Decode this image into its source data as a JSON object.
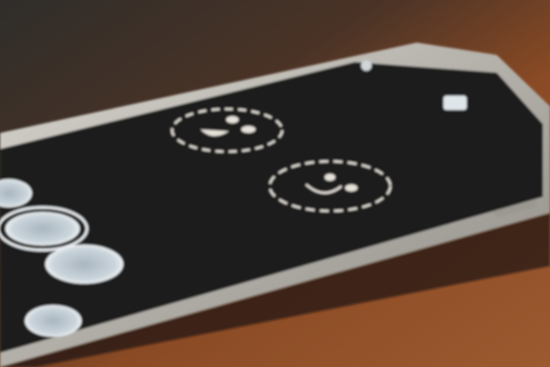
{
  "scene": {
    "subject": "smartphone",
    "colors": {
      "background_dark": "#2e2a26",
      "wood": "#8a4a24",
      "wood_light": "#b0693a",
      "phone_frame": "#c9c6bf",
      "screen": "#1e1d1a",
      "bubble": "#b9c7d2",
      "dashed_outline": "#e6e2da"
    },
    "screen_elements": {
      "bubble_count": 4,
      "dashed_face_count": 2
    }
  }
}
